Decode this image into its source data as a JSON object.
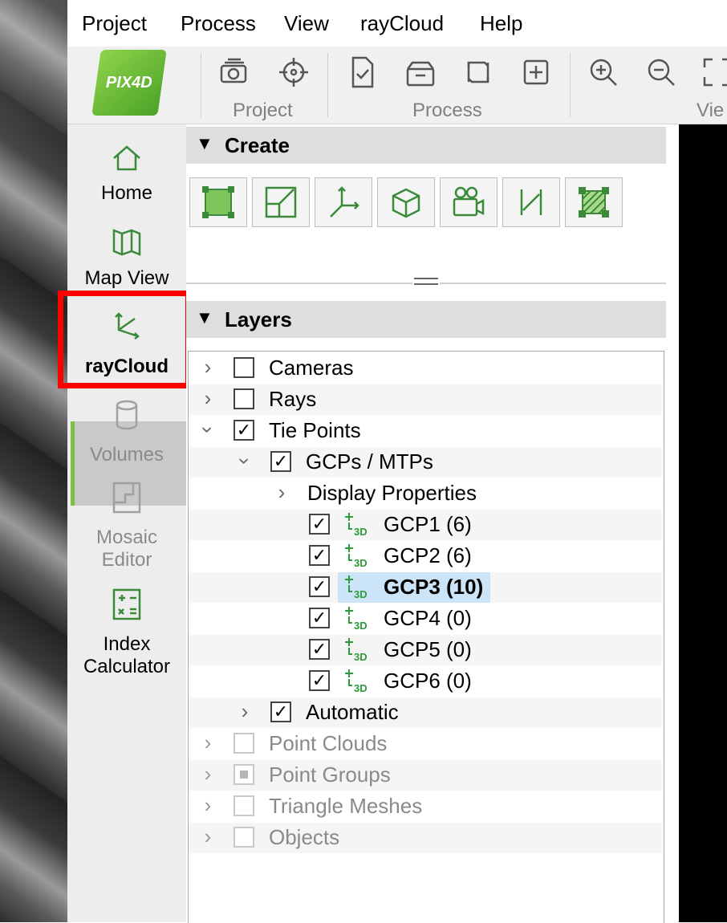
{
  "menubar": {
    "items": [
      "Project",
      "Process",
      "View",
      "rayCloud",
      "Help"
    ]
  },
  "logo": {
    "text": "PIX4D"
  },
  "toolbar": {
    "groups": [
      "Project",
      "Process",
      "Vie"
    ],
    "icons": [
      "camera-stack-icon",
      "target-icon",
      "document-check-icon",
      "open-box-icon",
      "refresh-icon",
      "add-process-icon",
      "zoom-in-icon",
      "zoom-out-icon",
      "fullscreen-icon"
    ]
  },
  "sidebar": {
    "items": [
      {
        "label": "Home",
        "icon": "home-icon"
      },
      {
        "label": "Map View",
        "icon": "map-icon"
      },
      {
        "label": "rayCloud",
        "icon": "raycloud-icon",
        "active": true
      },
      {
        "label": "Volumes",
        "icon": "cylinder-icon",
        "disabled": true
      },
      {
        "label": "Mosaic",
        "label2": "Editor",
        "icon": "mosaic-icon",
        "disabled": true
      },
      {
        "label": "Index",
        "label2": "Calculator",
        "icon": "calculator-icon"
      }
    ]
  },
  "create": {
    "title": "Create",
    "buttons": [
      "polyline-area-icon",
      "scale-constraint-icon",
      "orientation-axes-icon",
      "3d-box-icon",
      "video-animation-icon",
      "distance-icon",
      "surface-icon"
    ]
  },
  "layers": {
    "title": "Layers",
    "rows": [
      {
        "label": "Cameras",
        "checked": false,
        "expanded": false
      },
      {
        "label": "Rays",
        "checked": false,
        "expanded": false
      },
      {
        "label": "Tie Points",
        "checked": true,
        "expanded": true
      },
      {
        "label": "GCPs / MTPs",
        "checked": true,
        "expanded": true
      },
      {
        "label": "Display Properties"
      },
      {
        "label": "GCP1 (6)",
        "checked": true
      },
      {
        "label": "GCP2 (6)",
        "checked": true
      },
      {
        "label": "GCP3 (10)",
        "checked": true,
        "selected": true
      },
      {
        "label": "GCP4 (0)",
        "checked": true
      },
      {
        "label": "GCP5 (0)",
        "checked": true
      },
      {
        "label": "GCP6 (0)",
        "checked": true
      },
      {
        "label": "Automatic",
        "checked": true,
        "expanded": false
      },
      {
        "label": "Point Clouds",
        "disabled": true
      },
      {
        "label": "Point Groups",
        "disabled": true,
        "partial": true
      },
      {
        "label": "Triangle Meshes",
        "disabled": true
      },
      {
        "label": "Objects",
        "disabled": true
      }
    ],
    "check_mark": "✓",
    "gcp_icon": "gcp-3d-icon"
  },
  "colors": {
    "accent": "#79c043",
    "highlight": "#ff0000",
    "selection": "#cce4f7",
    "gcp_green": "#2e9b3a"
  }
}
